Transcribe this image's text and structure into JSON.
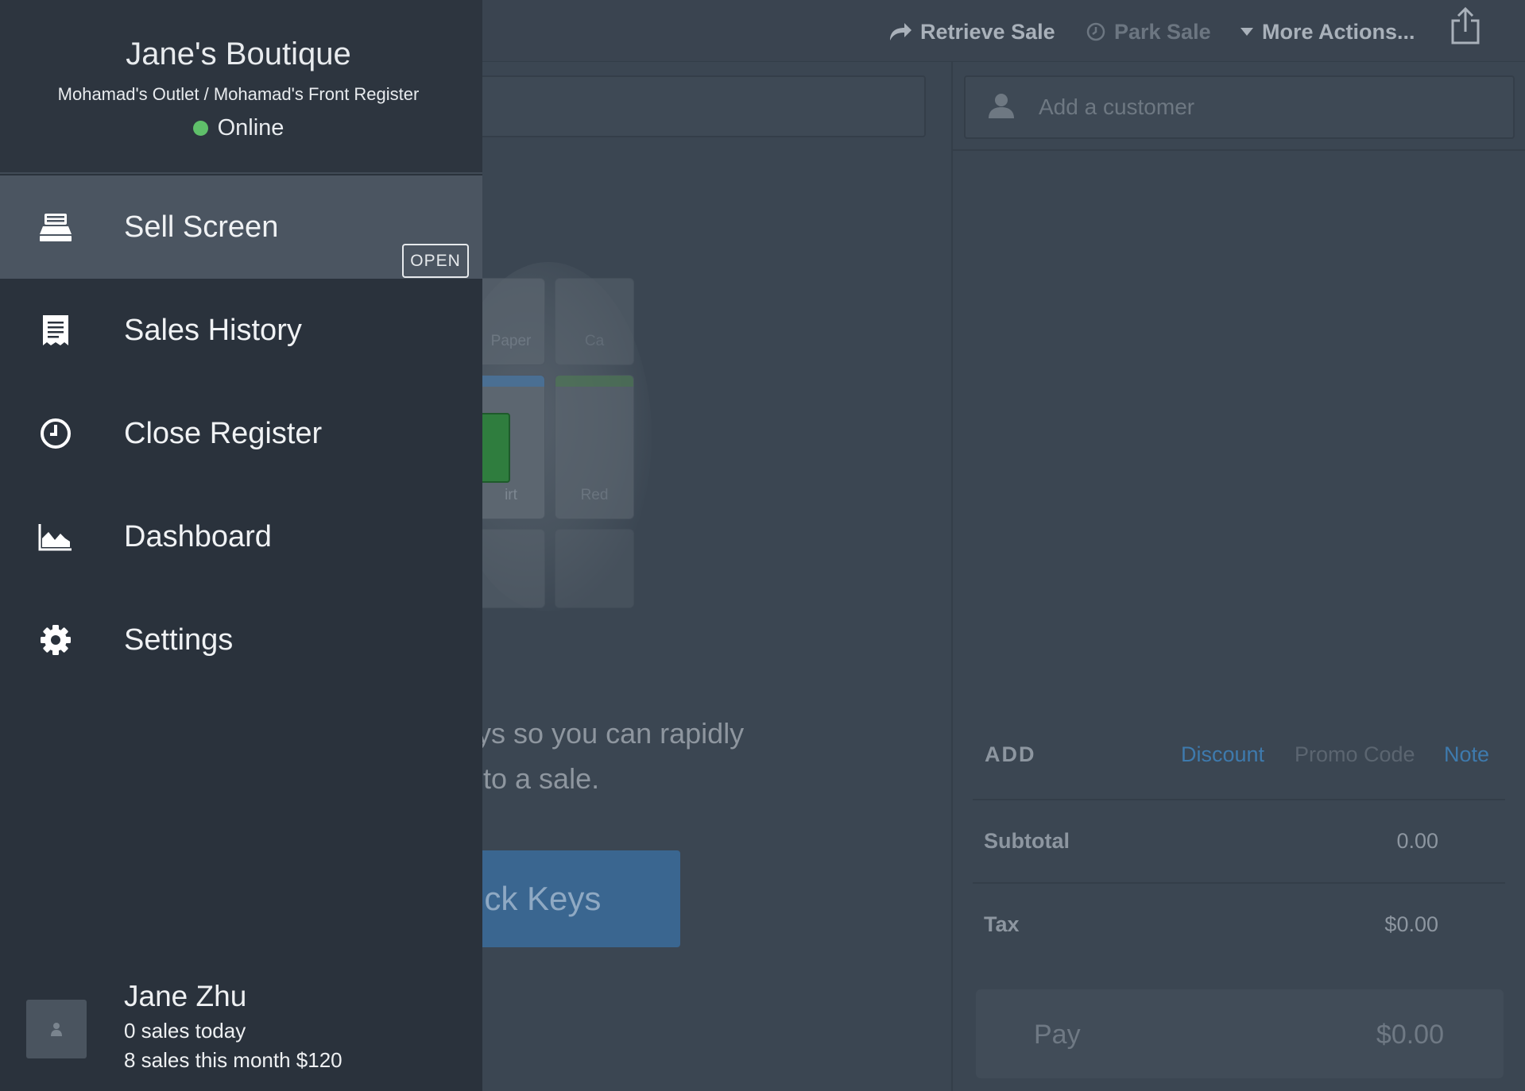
{
  "topbar": {
    "retrieve_sale": "Retrieve Sale",
    "park_sale": "Park Sale",
    "more_actions": "More Actions...",
    "share_icon": "share-icon"
  },
  "quick_keys": {
    "tile_labels": [
      "Paper",
      "Ca",
      "irt",
      "Red"
    ],
    "help_line1": "eys so you can rapidly",
    "help_line2": "s to a sale.",
    "button": "ick Keys"
  },
  "sale": {
    "customer_placeholder": "Add a customer",
    "add_label": "ADD",
    "discount": "Discount",
    "promo_code": "Promo Code",
    "note": "Note",
    "subtotal_label": "Subtotal",
    "subtotal_value": "0.00",
    "tax_label": "Tax",
    "tax_value": "$0.00",
    "pay_label": "Pay",
    "pay_value": "$0.00"
  },
  "drawer": {
    "store_name": "Jane's Boutique",
    "outlet_register": "Mohamad's Outlet / Mohamad's Front Register",
    "status": "Online",
    "status_color": "#5fbf6a",
    "nav": [
      {
        "label": "Sell Screen",
        "icon": "register-icon",
        "badge": "OPEN",
        "active": true
      },
      {
        "label": "Sales History",
        "icon": "receipt-icon"
      },
      {
        "label": "Close Register",
        "icon": "clock-icon"
      },
      {
        "label": "Dashboard",
        "icon": "chart-icon"
      },
      {
        "label": "Settings",
        "icon": "gear-icon"
      }
    ],
    "user": {
      "name": "Jane Zhu",
      "sales_today": "0 sales today",
      "sales_month": "8 sales this month $120"
    }
  },
  "colors": {
    "drawer_bg": "#2a323c",
    "active_bg": "#4b5561",
    "link_blue": "#3e7aad",
    "quick_keys_button": "#3a6690"
  }
}
